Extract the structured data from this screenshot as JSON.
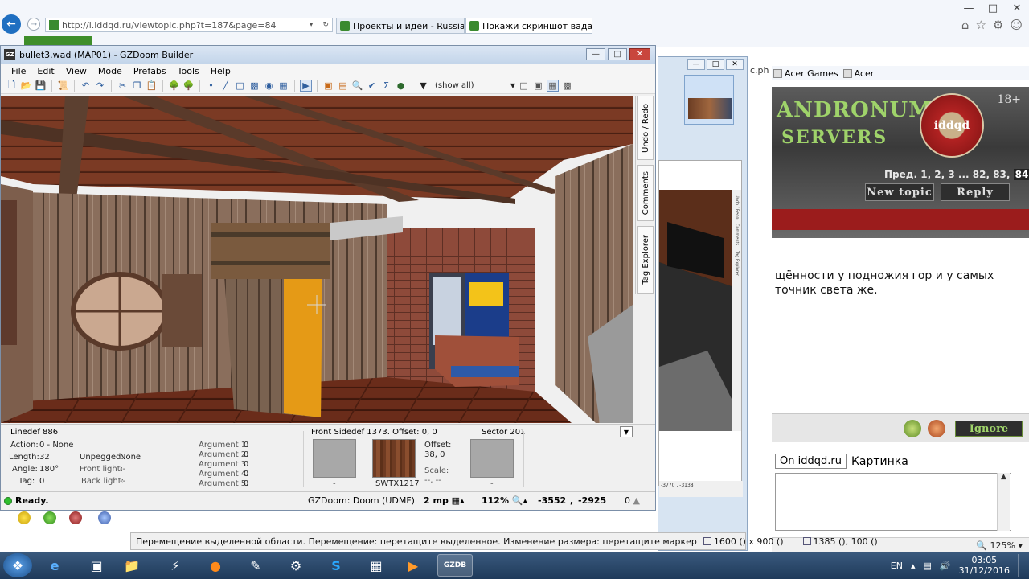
{
  "ie": {
    "url": "http://i.iddqd.ru/viewtopic.php?t=187&page=84",
    "tabs": [
      {
        "label": "Проекты и идеи - Russian Do..."
      },
      {
        "label": "Покажи скриншот вада, н..."
      }
    ],
    "favorites": [
      "Acer Games",
      "Acer"
    ],
    "url_fragment": "c.ph",
    "zoom": "125%"
  },
  "forum": {
    "age": "18+",
    "pagination_prefix": "Пред.",
    "pages": "1, 2, 3 ... 82, 83,",
    "current_page": "84",
    "new_topic": "New topic",
    "reply": "Reply",
    "text_line1": "щённости у подножия гор и у самых",
    "text_line2": "точник света же.",
    "ignore": "Ignore",
    "reply_tab": "On iddqd.ru",
    "reply_tab2": "Картинка"
  },
  "preview": {
    "status_coords": "-3770 , -3138",
    "mini_sidebar": [
      "Undo / Redo",
      "Comments",
      "Tag Explorer"
    ]
  },
  "gz": {
    "title": "bullet3.wad (MAP01) - GZDoom Builder",
    "menu": [
      "File",
      "Edit",
      "View",
      "Mode",
      "Prefabs",
      "Tools",
      "Help"
    ],
    "filter": "(show all)",
    "side_tabs": [
      "Undo / Redo",
      "Comments",
      "Tag Explorer"
    ],
    "linedef": {
      "header": "Linedef 886",
      "action_label": "Action:",
      "action": "0 - None",
      "length_label": "Length:",
      "length": "32",
      "angle_label": "Angle:",
      "angle": "180°",
      "tag_label": "Tag:",
      "tag": "0",
      "unpegged_label": "Unpegged:",
      "unpegged": "None",
      "frontlight_label": "Front light:",
      "frontlight": "--",
      "backlight_label": "Back light:",
      "backlight": "--",
      "args": [
        {
          "label": "Argument 1:",
          "value": "0"
        },
        {
          "label": "Argument 2:",
          "value": "0"
        },
        {
          "label": "Argument 3:",
          "value": "0"
        },
        {
          "label": "Argument 4:",
          "value": "0"
        },
        {
          "label": "Argument 5:",
          "value": "0"
        }
      ]
    },
    "sidedef": {
      "header": "Front Sidedef 1373. Offset: 0, 0",
      "tex_upper": "-",
      "tex_middle": "SWTX1217",
      "tex_lower": "-",
      "offset_label": "Offset:",
      "offset": "38, 0",
      "scale_label": "Scale:",
      "scale": "--, --"
    },
    "sector": {
      "header": "Sector 201",
      "tex": "-"
    },
    "status": {
      "ready": "Ready.",
      "engine": "GZDoom: Doom (UDMF)",
      "grid": "2 mp",
      "zoom": "112%",
      "x": "-3552",
      "comma": ",",
      "y": "-2925",
      "zero": "0"
    }
  },
  "bottom_status": {
    "text": "Перемещение выделенной области. Перемещение: перетащите выделенное. Изменение размера: перетащите маркер",
    "size1": "1600 () x 900 ()",
    "size2": "1385 (), 100 ()"
  },
  "taskbar": {
    "lang": "EN",
    "time": "03:05",
    "date": "31/12/2016",
    "gzdb_label": "GZDB"
  },
  "colors": {
    "accent": "#1f6fc1",
    "forum_green": "#9fd36a",
    "forum_red": "#9b1c1c",
    "ready_led": "#2fbf2f"
  }
}
